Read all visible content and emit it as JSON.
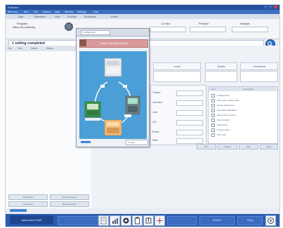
{
  "window": {
    "title": "Software"
  },
  "menu": [
    "Item one",
    "Item",
    "File",
    "Options",
    "Help",
    "Window",
    "Settings",
    "Tools"
  ],
  "tabs": [
    "Start",
    "Operations",
    "View",
    "Modules",
    "Monitoring",
    "Extras"
  ],
  "info": {
    "left_line1": "Program",
    "left_line2": "status_test_monitoring",
    "headers": [
      "Lot No.",
      "Product",
      "Sample"
    ],
    "message": "1 setting completed",
    "search_icon": "search-icon"
  },
  "sidebar": {
    "columns": [
      "No.",
      "Info",
      "Name",
      "Status"
    ],
    "bottom_buttons": [
      "Add device",
      "Remove device",
      "Add group",
      "Remove group"
    ]
  },
  "main": {
    "headers": [
      "Level",
      "Grade",
      "Comment"
    ],
    "form_labels": [
      "Transfer",
      "Operation",
      "Load",
      "Unit",
      "Recipe",
      "Batch"
    ],
    "list_headers": [
      "Item",
      "Description"
    ],
    "list_items": [
      "Configuration",
      "Parameter setting value",
      "Device adjustment",
      "Automatic calibration",
      "Measurement setup",
      "Record detail",
      "Data check",
      "Process data",
      "Auto load"
    ],
    "buttons": [
      "Run",
      "Cancel",
      "Step",
      "Save"
    ]
  },
  "popup": {
    "title": "Configuration",
    "header_text": "Station Overview Module",
    "slider_label": "Ready",
    "labels": [
      "Input",
      "Unit station",
      "Output"
    ]
  },
  "taskbar": {
    "start": "Application Start",
    "right_items": [
      "Monitor",
      "Setup"
    ],
    "icons": [
      "document-icon",
      "chart-icon",
      "settings-icon",
      "clipboard-icon",
      "export-icon",
      "calculator-icon",
      "help-icon"
    ]
  },
  "colors": {
    "titlebar": "#244f9e",
    "menubar": "#3d70c2",
    "taskbar": "#2d5db2",
    "diagram_background": "#4b9fd6",
    "popup_header": "#d99a9a"
  }
}
